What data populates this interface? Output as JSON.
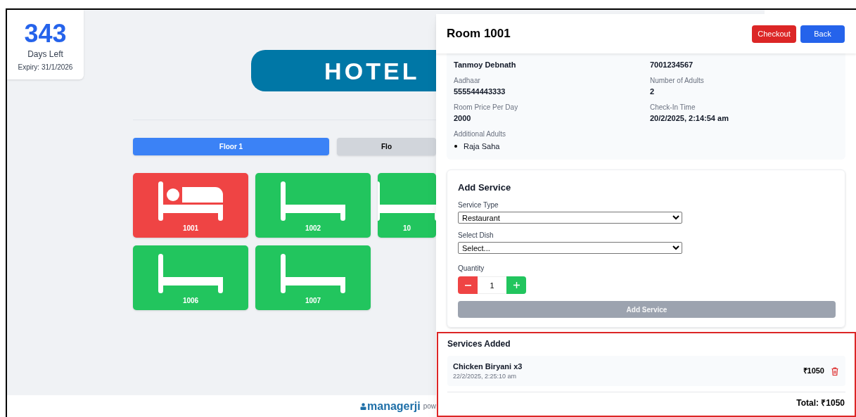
{
  "days_card": {
    "count": "343",
    "label": "Days Left",
    "expiry": "Expiry: 31/1/2026"
  },
  "banner": {
    "text": "HOTEL"
  },
  "floors": [
    {
      "label": "Floor 1",
      "selected": true
    },
    {
      "label": "Flo",
      "selected": false
    }
  ],
  "rooms": [
    {
      "number": "1001",
      "occupied": true
    },
    {
      "number": "1002",
      "occupied": false
    },
    {
      "number": "10",
      "occupied": false
    },
    {
      "number": "1006",
      "occupied": false
    },
    {
      "number": "1007",
      "occupied": false
    }
  ],
  "footer": {
    "brand": "managerji",
    "text": "pow"
  },
  "panel": {
    "title": "Room 1001",
    "buttons": [
      {
        "label": "Checkout",
        "kind": "danger"
      },
      {
        "label": "Back",
        "kind": "primary"
      }
    ],
    "fields": [
      {
        "value": "Tanmoy Debnath"
      },
      {
        "value": "7001234567"
      },
      {
        "label": "Aadhaar",
        "value": "555544443333"
      },
      {
        "label": "Number of Adults",
        "value": "2"
      },
      {
        "label": "Room Price Per Day",
        "value": "2000"
      },
      {
        "label": "Check-In Time",
        "value": "20/2/2025, 2:14:54 am"
      }
    ],
    "additional_adults": {
      "label": "Additional Adults",
      "names": [
        "Raja Saha"
      ]
    },
    "add_service": {
      "title": "Add Service",
      "service_type": {
        "label": "Service Type",
        "value": "Restaurant"
      },
      "dish": {
        "label": "Select Dish",
        "value": "Select..."
      },
      "quantity": {
        "label": "Quantity",
        "value": "1"
      },
      "button": {
        "label": "Add Service",
        "disabled": true
      }
    },
    "services_added": {
      "title": "Services Added",
      "items": [
        {
          "name": "Chicken Biryani x3",
          "time": "22/2/2025, 2:25:10 am",
          "price": "₹1050"
        }
      ],
      "total": "Total: ₹1050"
    }
  }
}
